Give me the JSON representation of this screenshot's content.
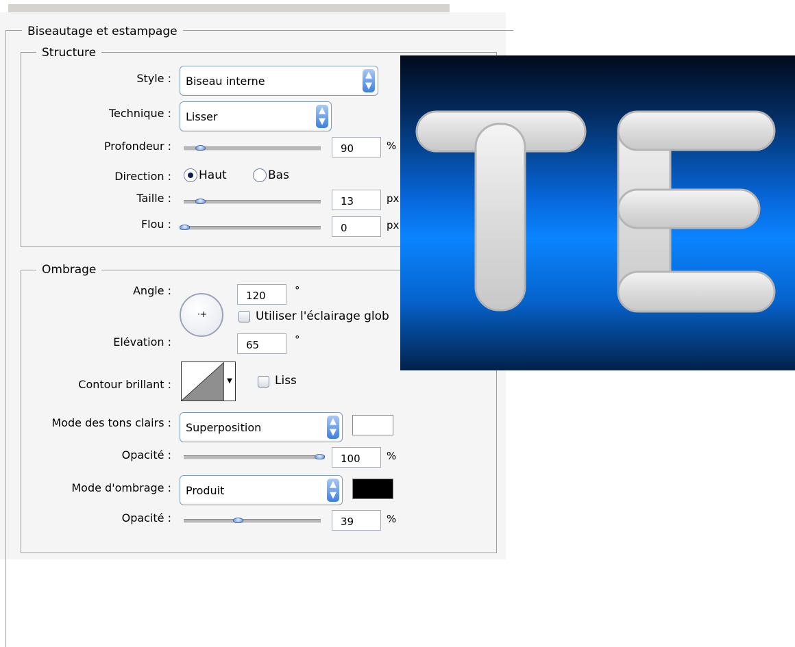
{
  "panel": {
    "section_title": "Biseautage et estampage"
  },
  "structure": {
    "title": "Structure",
    "style_label": "Style :",
    "style_value": "Biseau interne",
    "technique_label": "Technique :",
    "technique_value": "Lisser",
    "profondeur_label": "Profondeur :",
    "profondeur_value": "90",
    "profondeur_unit": "%",
    "profondeur_slider_fraction": 0.09,
    "direction_label": "Direction :",
    "direction_haut": "Haut",
    "direction_bas": "Bas",
    "direction_selected": "Haut",
    "taille_label": "Taille :",
    "taille_value": "13",
    "taille_unit": "px",
    "taille_slider_fraction": 0.09,
    "flou_label": "Flou :",
    "flou_value": "0",
    "flou_unit": "px",
    "flou_slider_fraction": 0.0
  },
  "ombrage": {
    "title": "Ombrage",
    "angle_label": "Angle :",
    "angle_value": "120",
    "angle_unit": "°",
    "global_light_label": "Utiliser l'éclairage glob",
    "global_light_checked": false,
    "elevation_label": "Elévation :",
    "elevation_value": "65",
    "elevation_unit": "°",
    "contour_label": "Contour brillant :",
    "lisse_label": "Liss",
    "lisse_checked": false,
    "highlight_mode_label": "Mode des tons clairs :",
    "highlight_mode_value": "Superposition",
    "highlight_color": "#ffffff",
    "highlight_opacity_label": "Opacité :",
    "highlight_opacity_value": "100",
    "highlight_opacity_unit": "%",
    "highlight_opacity_fraction": 1.0,
    "shadow_mode_label": "Mode d'ombrage :",
    "shadow_mode_value": "Produit",
    "shadow_color": "#000000",
    "shadow_opacity_label": "Opacité :",
    "shadow_opacity_value": "39",
    "shadow_opacity_unit": "%",
    "shadow_opacity_fraction": 0.39
  },
  "preview": {
    "text": "TE",
    "text_color": "#e6e6e6",
    "background_color": "#0a84ff"
  }
}
